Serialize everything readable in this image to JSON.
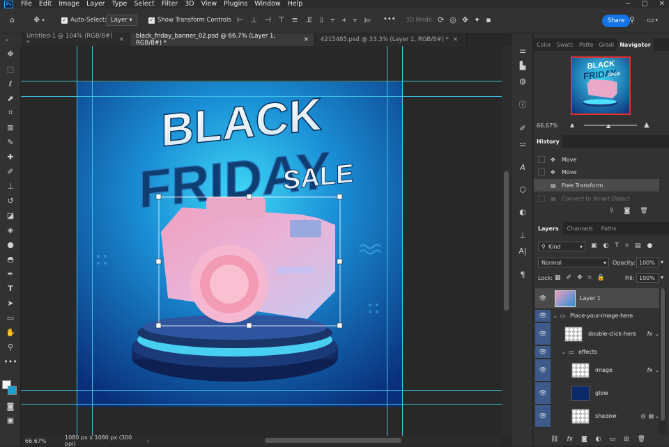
{
  "menu": [
    "File",
    "Edit",
    "Image",
    "Layer",
    "Type",
    "Select",
    "Filter",
    "3D",
    "View",
    "Plugins",
    "Window",
    "Help"
  ],
  "app_logo": "Ps",
  "options": {
    "auto_select_label": "Auto-Select:",
    "auto_select_value": "Layer",
    "show_transform_label": "Show Transform Controls",
    "mode_3d_label": "3D Mode:",
    "share_label": "Share",
    "more": "•••"
  },
  "tabs": [
    {
      "label": "Untitled-1 @ 104% (RGB/8#) *",
      "close": "×"
    },
    {
      "label": "black_friday_banner_02.psd @ 66.7% (Layer 1, RGB/8#) *",
      "close": "×"
    },
    {
      "label": "4215485.psd @ 33.3% (Layer 1, RGB/8#) *",
      "close": "×"
    }
  ],
  "artwork": {
    "line1": "BLACK",
    "line2": "FRIDAY",
    "line3": "SALE"
  },
  "status": {
    "zoom": "66.67%",
    "doc_info": "1080 px x 1080 px (300 ppi)",
    "arrow": "›"
  },
  "navigator": {
    "tabs": [
      "Color",
      "Swatc",
      "Patte",
      "Gradi",
      "Navigator"
    ],
    "zoom": "66.67%"
  },
  "history": {
    "title": "History",
    "items": [
      "Move",
      "Move",
      "Free Transform",
      "Convert to Smart Object"
    ]
  },
  "layers": {
    "tabs": [
      "Layers",
      "Channels",
      "Paths"
    ],
    "kind_label": "Kind",
    "blend_mode": "Normal",
    "opacity_label": "Opacity:",
    "opacity_value": "100%",
    "lock_label": "Lock:",
    "fill_label": "Fill:",
    "fill_value": "100%",
    "rows": [
      {
        "name": "Layer 1",
        "fx": ""
      },
      {
        "name": "Place-your-image-here",
        "fx": ""
      },
      {
        "name": "double-click-here",
        "fx": "fx"
      },
      {
        "name": "effects",
        "fx": ""
      },
      {
        "name": "image",
        "fx": "fx"
      },
      {
        "name": "glow",
        "fx": ""
      },
      {
        "name": "shadow",
        "fx": ""
      }
    ]
  },
  "colors": {
    "accent": "#31a8ff",
    "guide": "#3ec6e6",
    "bg_blue": "#1a8fd6",
    "selected_row": "#4a4a4a",
    "layer_blue": "#3d5a8a"
  }
}
